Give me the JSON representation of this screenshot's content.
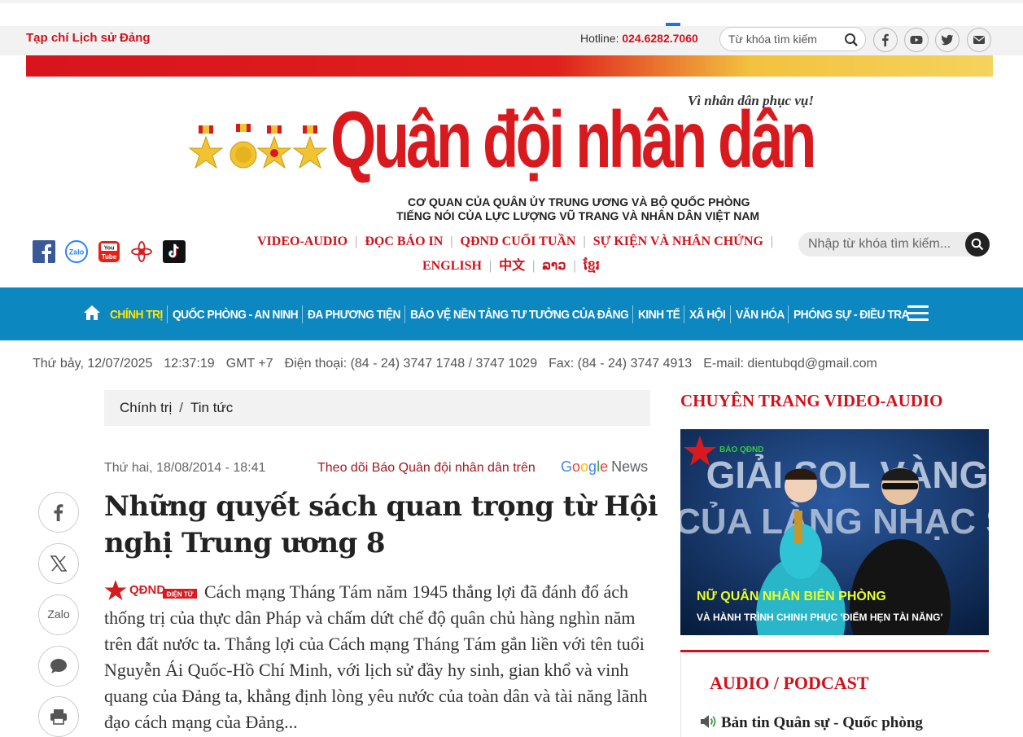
{
  "utility": {
    "site_label": "Tạp chí Lịch sử Đảng",
    "hotline_label": "Hotline:",
    "hotline_number": "024.6282.7060",
    "search_placeholder": "Từ khóa tìm kiếm",
    "social": [
      "facebook-icon",
      "youtube-icon",
      "twitter-icon",
      "mail-icon"
    ]
  },
  "masthead": {
    "slogan": "Vì nhân dân phục vụ!",
    "logo": "Quân đội nhân dân",
    "org_line1": "CƠ QUAN CỦA QUÂN ỦY TRUNG ƯƠNG VÀ BỘ QUỐC PHÒNG",
    "org_line2": "TIẾNG NÓI CỦA LỰC LƯỢNG VŨ TRANG VÀ NHÂN DÂN VIỆT NAM"
  },
  "app_icons": [
    "facebook-icon",
    "zalo-icon",
    "youtube-icon",
    "lotus-icon",
    "tiktok-icon"
  ],
  "section_links": {
    "row1": [
      "VIDEO-AUDIO",
      "ĐỌC BÁO IN",
      "QĐND CUỐI TUẦN",
      "SỰ KIỆN VÀ NHÂN CHỨNG"
    ],
    "row2": [
      "ENGLISH",
      "中文",
      "ລາວ",
      "ខ្មែរ"
    ]
  },
  "main_search": {
    "placeholder": "Nhập từ khóa tìm kiếm..."
  },
  "nav": {
    "items": [
      "CHÍNH TRỊ",
      "QUỐC PHÒNG - AN NINH",
      "ĐA PHƯƠNG TIỆN",
      "BẢO VỆ NỀN TẢNG TƯ TƯỞNG CỦA ĐẢNG",
      "KINH TẾ",
      "XÃ HỘI",
      "VĂN HÓA",
      "PHÓNG SỰ - ĐIỀU TRA"
    ],
    "active_index": 0,
    "color": "#0d87c0",
    "active_color": "#ffe600"
  },
  "info": {
    "date": "Thứ bảy, 12/07/2025",
    "time": "12:37:19",
    "tz": "GMT +7",
    "phone": "Điện thoại: (84 - 24) 3747 1748 / 3747 1029",
    "fax": "Fax: (84 - 24) 3747 4913",
    "email": "E-mail: dientubqd@gmail.com"
  },
  "breadcrumb": {
    "parent": "Chính trị",
    "sep": "/",
    "current": "Tin tức"
  },
  "article": {
    "date": "Thứ hai, 18/08/2014 - 18:41",
    "follow_text": "Theo dõi Báo Quân đội nhân dân trên",
    "gnews_google": [
      "G",
      "o",
      "o",
      "g",
      "l",
      "e"
    ],
    "gnews_news": "News",
    "title": "Những quyết sách quan trọng từ Hội nghị Trung ương 8",
    "sapo": "Cách mạng Tháng Tám năm 1945 thắng lợi đã đánh đổ ách thống trị của thực dân Pháp và chấm dứt chế độ quân chủ hàng nghìn năm trên đất nước ta. Thắng lợi của Cách mạng Tháng Tám gắn liền với tên tuổi Nguyễn Ái Quốc-Hồ Chí Minh, với lịch sử đầy hy sinh, gian khổ và vinh quang của Đảng ta, khẳng định lòng yêu nước của toàn dân và tài năng lãnh đạo cách mạng của Đảng...",
    "badge_text": "QĐND",
    "badge_sub": "ĐIỆN TỬ"
  },
  "share": {
    "zalo_label": "Zalo",
    "buttons": [
      "facebook-icon",
      "x-icon",
      "zalo-icon",
      "comment-icon",
      "print-icon"
    ]
  },
  "sidebar": {
    "video_heading": "CHUYÊN TRANG VIDEO-AUDIO",
    "video_title_line1": "GIẢI SOL VÀNG",
    "video_title_line2": "CỦA LÀNG NHẠC SĨ",
    "video_caption1": "NỮ QUÂN NHÂN BIÊN PHÒNG",
    "video_caption2": "VÀ HÀNH TRÌNH CHINH PHỤC 'ĐIỂM HẸN TÀI NĂNG'",
    "video_badge": "BÁO QĐND",
    "audio_heading": "AUDIO / PODCAST",
    "audio_item": "Bản tin Quân sự - Quốc phòng"
  }
}
